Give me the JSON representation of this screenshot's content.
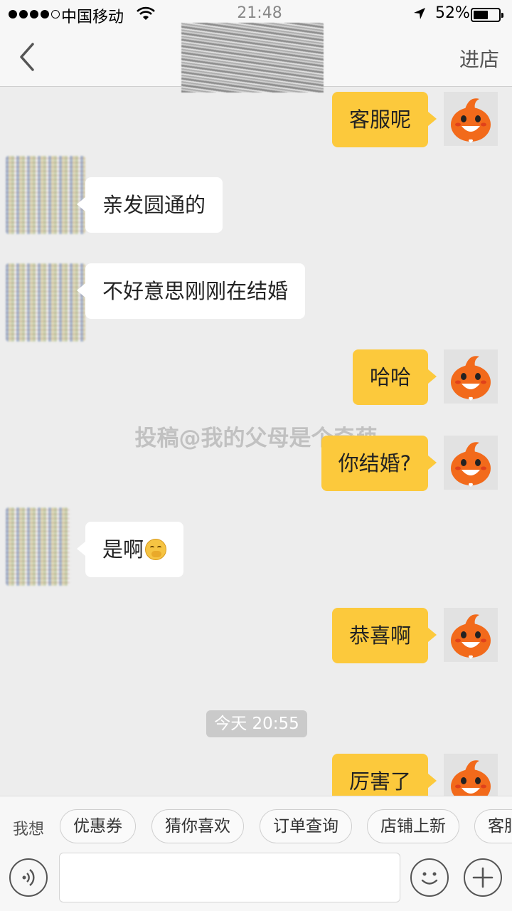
{
  "status_bar": {
    "carrier": "中国移动",
    "time": "21:48",
    "battery_percent": "52%",
    "battery_level": 0.52,
    "signal_bars_filled": 4,
    "signal_bars_total": 5
  },
  "nav": {
    "back_icon": "chevron-left-icon",
    "enter_store_label": "进店"
  },
  "messages": [
    {
      "from": "me",
      "text": "客服呢"
    },
    {
      "from": "seller",
      "text": "亲发圆通的"
    },
    {
      "from": "seller",
      "text": "不好意思刚刚在结婚"
    },
    {
      "from": "me",
      "text": "哈哈"
    },
    {
      "from": "me",
      "text": "你结婚?"
    },
    {
      "from": "seller",
      "text": "是啊",
      "emoji": "yawning-face-emoji"
    },
    {
      "from": "me",
      "text": "恭喜啊"
    },
    {
      "from": "me",
      "text": "厉害了"
    }
  ],
  "time_divider": "今天 20:55",
  "watermark": "投稿@我的父母是个奇葩",
  "quick_replies": {
    "label": "我想",
    "chips": [
      "优惠券",
      "猜你喜欢",
      "订单查询",
      "店铺上新",
      "客服"
    ]
  },
  "input_bar": {
    "voice_icon": "voice-icon",
    "emoji_icon": "smiley-icon",
    "plus_icon": "plus-icon",
    "placeholder": ""
  },
  "colors": {
    "outgoing_bubble": "#fcc93c",
    "incoming_bubble": "#ffffff",
    "background": "#ededed",
    "avatar_mascot": "#f26a1b"
  }
}
